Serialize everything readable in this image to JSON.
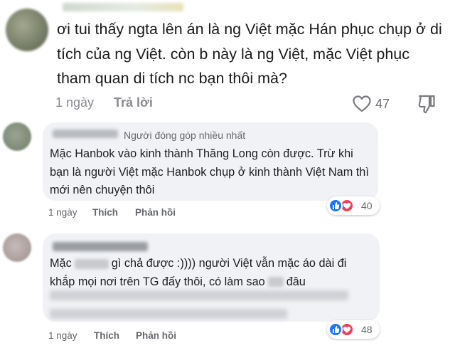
{
  "comment1": {
    "text": "ơi tui thấy ngta lên án là ng Việt mặc Hán phục chụp ở di tích của ng Việt. còn b này là ng Việt, mặc Việt phục tham quan di tích nc bạn thôi mà?",
    "time": "1 ngày",
    "reply_label": "Trả lời",
    "likes": "47"
  },
  "comment2": {
    "badge": "Người đóng góp nhiều nhất",
    "text": "Mặc Hanbok vào kinh thành Thăng Long còn được. Trừ khi bạn là người Việt mặc Hanbok chụp ở kinh thành Việt Nam thì mới nên chuyện thôi",
    "time": "1 ngày",
    "like_label": "Thích",
    "reply_label": "Phản hồi",
    "reaction_count": "40"
  },
  "comment3": {
    "line1_start": "Mặc",
    "line1_end": "gì chả được :)))) người Việt vẫn mặc áo dài đi",
    "line2_start": "khắp mọi nơi trên TG đấy thôi, có làm sao",
    "line2_end": "đâu",
    "time": "1 ngày",
    "like_label": "Thích",
    "reply_label": "Phản hồi",
    "reaction_count": "48"
  },
  "colors": {
    "meta_gray": "#65676b",
    "bubble_bg": "#f0f2f5",
    "like_blue": "#1877f2",
    "love_red": "#f33e58"
  }
}
